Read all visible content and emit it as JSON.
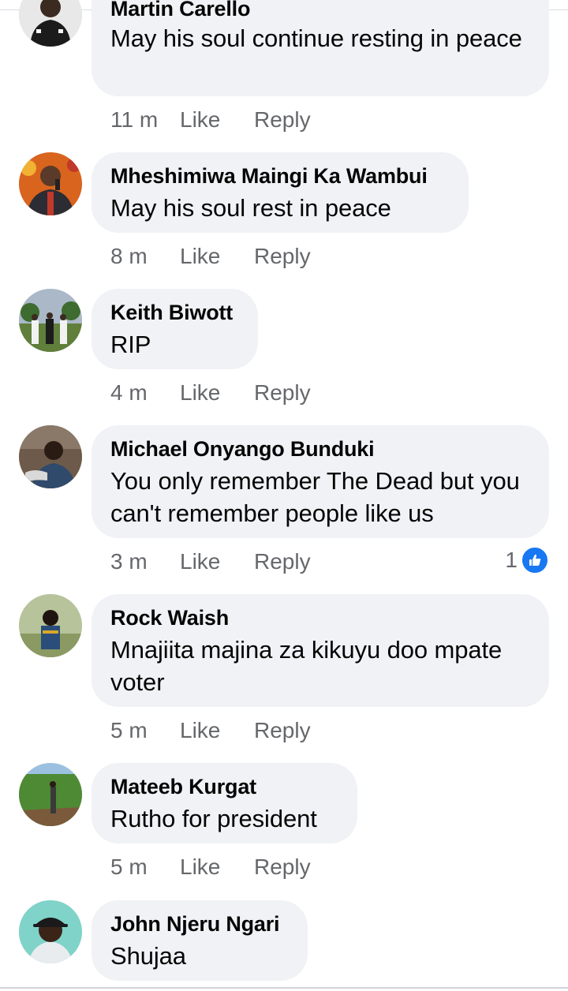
{
  "actions": {
    "like_label": "Like",
    "reply_label": "Reply"
  },
  "comments": [
    {
      "author": "Martin Carello",
      "text": "May his soul continue resting in peace",
      "time": "11 m"
    },
    {
      "author": "Mheshimiwa Maingi Ka Wambui",
      "text": "May his soul rest in peace",
      "time": "8 m"
    },
    {
      "author": "Keith Biwott",
      "text": "RIP",
      "time": "4 m"
    },
    {
      "author": "Michael Onyango Bunduki",
      "text": "You only remember The Dead but you can't remember people like us",
      "time": "3 m",
      "reaction_count": "1",
      "reaction_icon": "thumbs-up-icon"
    },
    {
      "author": "Rock Waish",
      "text": "Mnajiita majina za kikuyu doo mpate voter",
      "time": "5 m"
    },
    {
      "author": "Mateeb Kurgat",
      "text": "Rutho for president",
      "time": "5 m"
    },
    {
      "author": "John Njeru Ngari",
      "text": "Shujaa"
    }
  ],
  "colors": {
    "bubble": "#f0f2f5",
    "meta": "#65676b",
    "like_blue": "#1877f2"
  }
}
